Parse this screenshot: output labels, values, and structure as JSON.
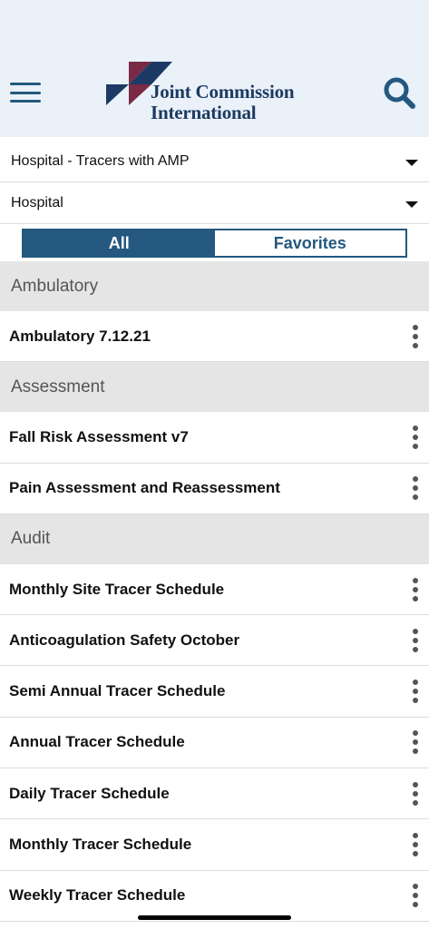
{
  "header": {
    "logo_line1": "Joint Commission",
    "logo_line2": "International",
    "brand_colors": {
      "navy": "#1c3a63",
      "maroon": "#7a2a45",
      "accent": "#24587e"
    }
  },
  "filters": {
    "program": "Hospital - Tracers with AMP",
    "setting": "Hospital"
  },
  "segment": {
    "all_label": "All",
    "favorites_label": "Favorites",
    "selected": "All"
  },
  "sections": [
    {
      "title": "Ambulatory",
      "items": [
        "Ambulatory 7.12.21"
      ]
    },
    {
      "title": "Assessment",
      "items": [
        "Fall Risk Assessment v7",
        "Pain Assessment and Reassessment"
      ]
    },
    {
      "title": "Audit",
      "items": [
        "Monthly Site Tracer Schedule",
        "Anticoagulation Safety October",
        "Semi Annual Tracer Schedule",
        "Annual Tracer Schedule",
        "Daily Tracer Schedule",
        "Monthly Tracer Schedule",
        "Weekly Tracer Schedule"
      ]
    }
  ]
}
